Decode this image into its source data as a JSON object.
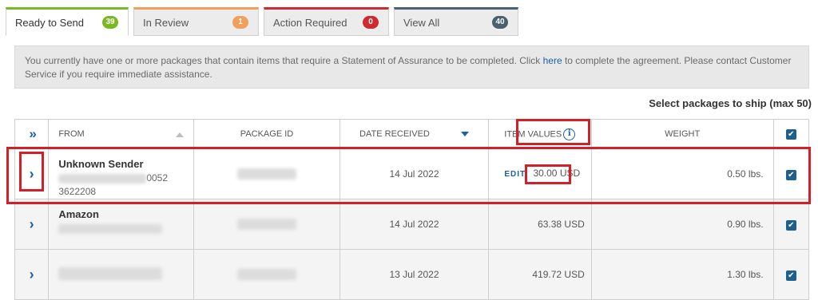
{
  "tabs": [
    {
      "label": "Ready to Send",
      "count": "39",
      "badge_color": "#7ab822"
    },
    {
      "label": "In Review",
      "count": "1",
      "badge_color": "#f0a05a"
    },
    {
      "label": "Action Required",
      "count": "0",
      "badge_color": "#cf2a30"
    },
    {
      "label": "View All",
      "count": "40",
      "badge_color": "#4a6070"
    }
  ],
  "notice": {
    "text_before": "You currently have one or more packages that contain items that require a Statement of Assurance to be completed. Click ",
    "link_text": "here",
    "text_after": " to complete the agreement. Please contact Customer Service if you require immediate assistance."
  },
  "select_caption": "Select packages to ship (max 50)",
  "table": {
    "headers": {
      "from": "FROM",
      "package_id": "PACKAGE ID",
      "date_received": "DATE RECEIVED",
      "item_values": "ITEM VALUES",
      "weight": "WEIGHT"
    },
    "icons": {
      "expand_all": "»",
      "expand_row": "›",
      "info": "i",
      "check": "✔"
    },
    "edit_label": "EDIT",
    "rows": [
      {
        "from_name": "Unknown Sender",
        "from_suffix": "0052",
        "from_line2": "3622208",
        "date": "14 Jul 2022",
        "value": "30.00 USD",
        "weight": "0.50 lbs."
      },
      {
        "from_name": "Amazon",
        "date": "14 Jul 2022",
        "value": "63.38 USD",
        "weight": "0.90 lbs."
      },
      {
        "date": "13 Jul 2022",
        "value": "419.72 USD",
        "weight": "1.30 lbs."
      }
    ]
  },
  "colors": {
    "accent_blue": "#1a5fa8",
    "checkbox": "#1f5f8c",
    "annotation_red": "#d21f28"
  }
}
